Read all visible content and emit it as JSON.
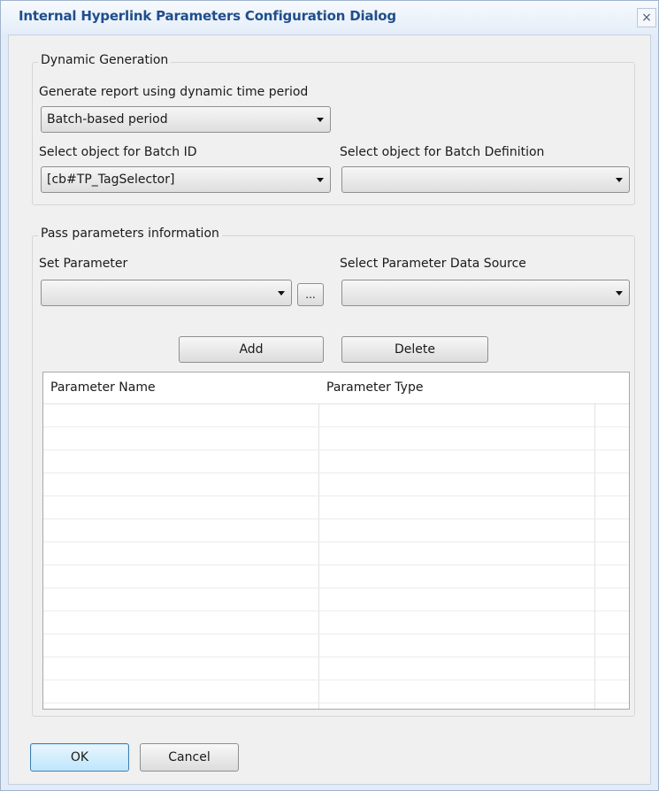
{
  "dialog": {
    "title": "Internal Hyperlink Parameters Configuration Dialog",
    "close_glyph": "×"
  },
  "dynamic_generation": {
    "group_title": "Dynamic Generation",
    "period_label": "Generate report using dynamic time period",
    "period_value": "Batch-based period",
    "batch_id_label": "Select object for Batch ID",
    "batch_id_value": "[cb#TP_TagSelector]",
    "batch_def_label": "Select object for Batch Definition",
    "batch_def_value": ""
  },
  "pass_parameters": {
    "group_title": "Pass parameters information",
    "set_param_label": "Set Parameter",
    "set_param_value": "",
    "browse_label": "...",
    "data_source_label": "Select Parameter Data Source",
    "data_source_value": "",
    "add_label": "Add",
    "delete_label": "Delete",
    "table": {
      "columns": [
        "Parameter Name",
        "Parameter Type"
      ],
      "rows": []
    }
  },
  "footer": {
    "ok_label": "OK",
    "cancel_label": "Cancel"
  },
  "colors": {
    "title_text": "#1f4e8c",
    "frame": "#e2ebf6",
    "client": "#f0f0f0",
    "ok_border": "#3c7fb1"
  }
}
